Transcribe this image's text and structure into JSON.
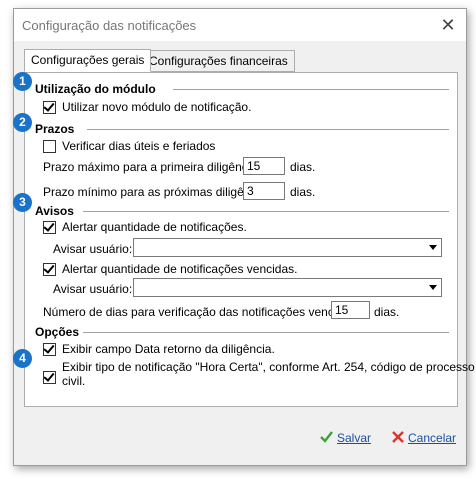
{
  "window": {
    "title": "Configuração das notificações"
  },
  "tabs": [
    {
      "label": "Configurações gerais",
      "active": true
    },
    {
      "label": "Configurações financeiras",
      "active": false
    }
  ],
  "sections": {
    "modulo": {
      "badge": "1",
      "title": "Utilização do módulo",
      "checkbox_label": "Utilizar novo módulo de notificação.",
      "checked": true
    },
    "prazos": {
      "badge": "2",
      "title": "Prazos",
      "checkbox_label": "Verificar dias úteis e feriados",
      "checked": false,
      "prazo_max_label": "Prazo máximo para a primeira diligência:",
      "prazo_max_value": "15",
      "prazo_max_unit": "dias.",
      "prazo_min_label": "Prazo mínimo para as próximas diligência:",
      "prazo_min_value": "3",
      "prazo_min_unit": "dias."
    },
    "avisos": {
      "badge": "3",
      "title": "Avisos",
      "alert1_label": "Alertar quantidade de notificações.",
      "alert1_checked": true,
      "user1_label": "Avisar usuário:",
      "user1_value": "",
      "alert2_label": "Alertar quantidade de notificações vencidas.",
      "alert2_checked": true,
      "user2_label": "Avisar usuário:",
      "user2_value": "",
      "days_label": "Número de dias para verificação das notificações vencidas:",
      "days_value": "15",
      "days_unit": "dias."
    },
    "opcoes": {
      "badge": "4",
      "title": "Opções",
      "opt1_label": "Exibir campo Data retorno da diligência.",
      "opt1_checked": true,
      "opt2_label_line1": "Exibir tipo de notificação \"Hora Certa\", conforme Art. 254, código de processo",
      "opt2_label_line2": "civil.",
      "opt2_checked": true
    }
  },
  "buttons": {
    "save": "Salvar",
    "cancel": "Cancelar"
  },
  "colors": {
    "badge": "#1a73c8",
    "save_icon": "#3aa335",
    "cancel_icon": "#d9342b"
  }
}
